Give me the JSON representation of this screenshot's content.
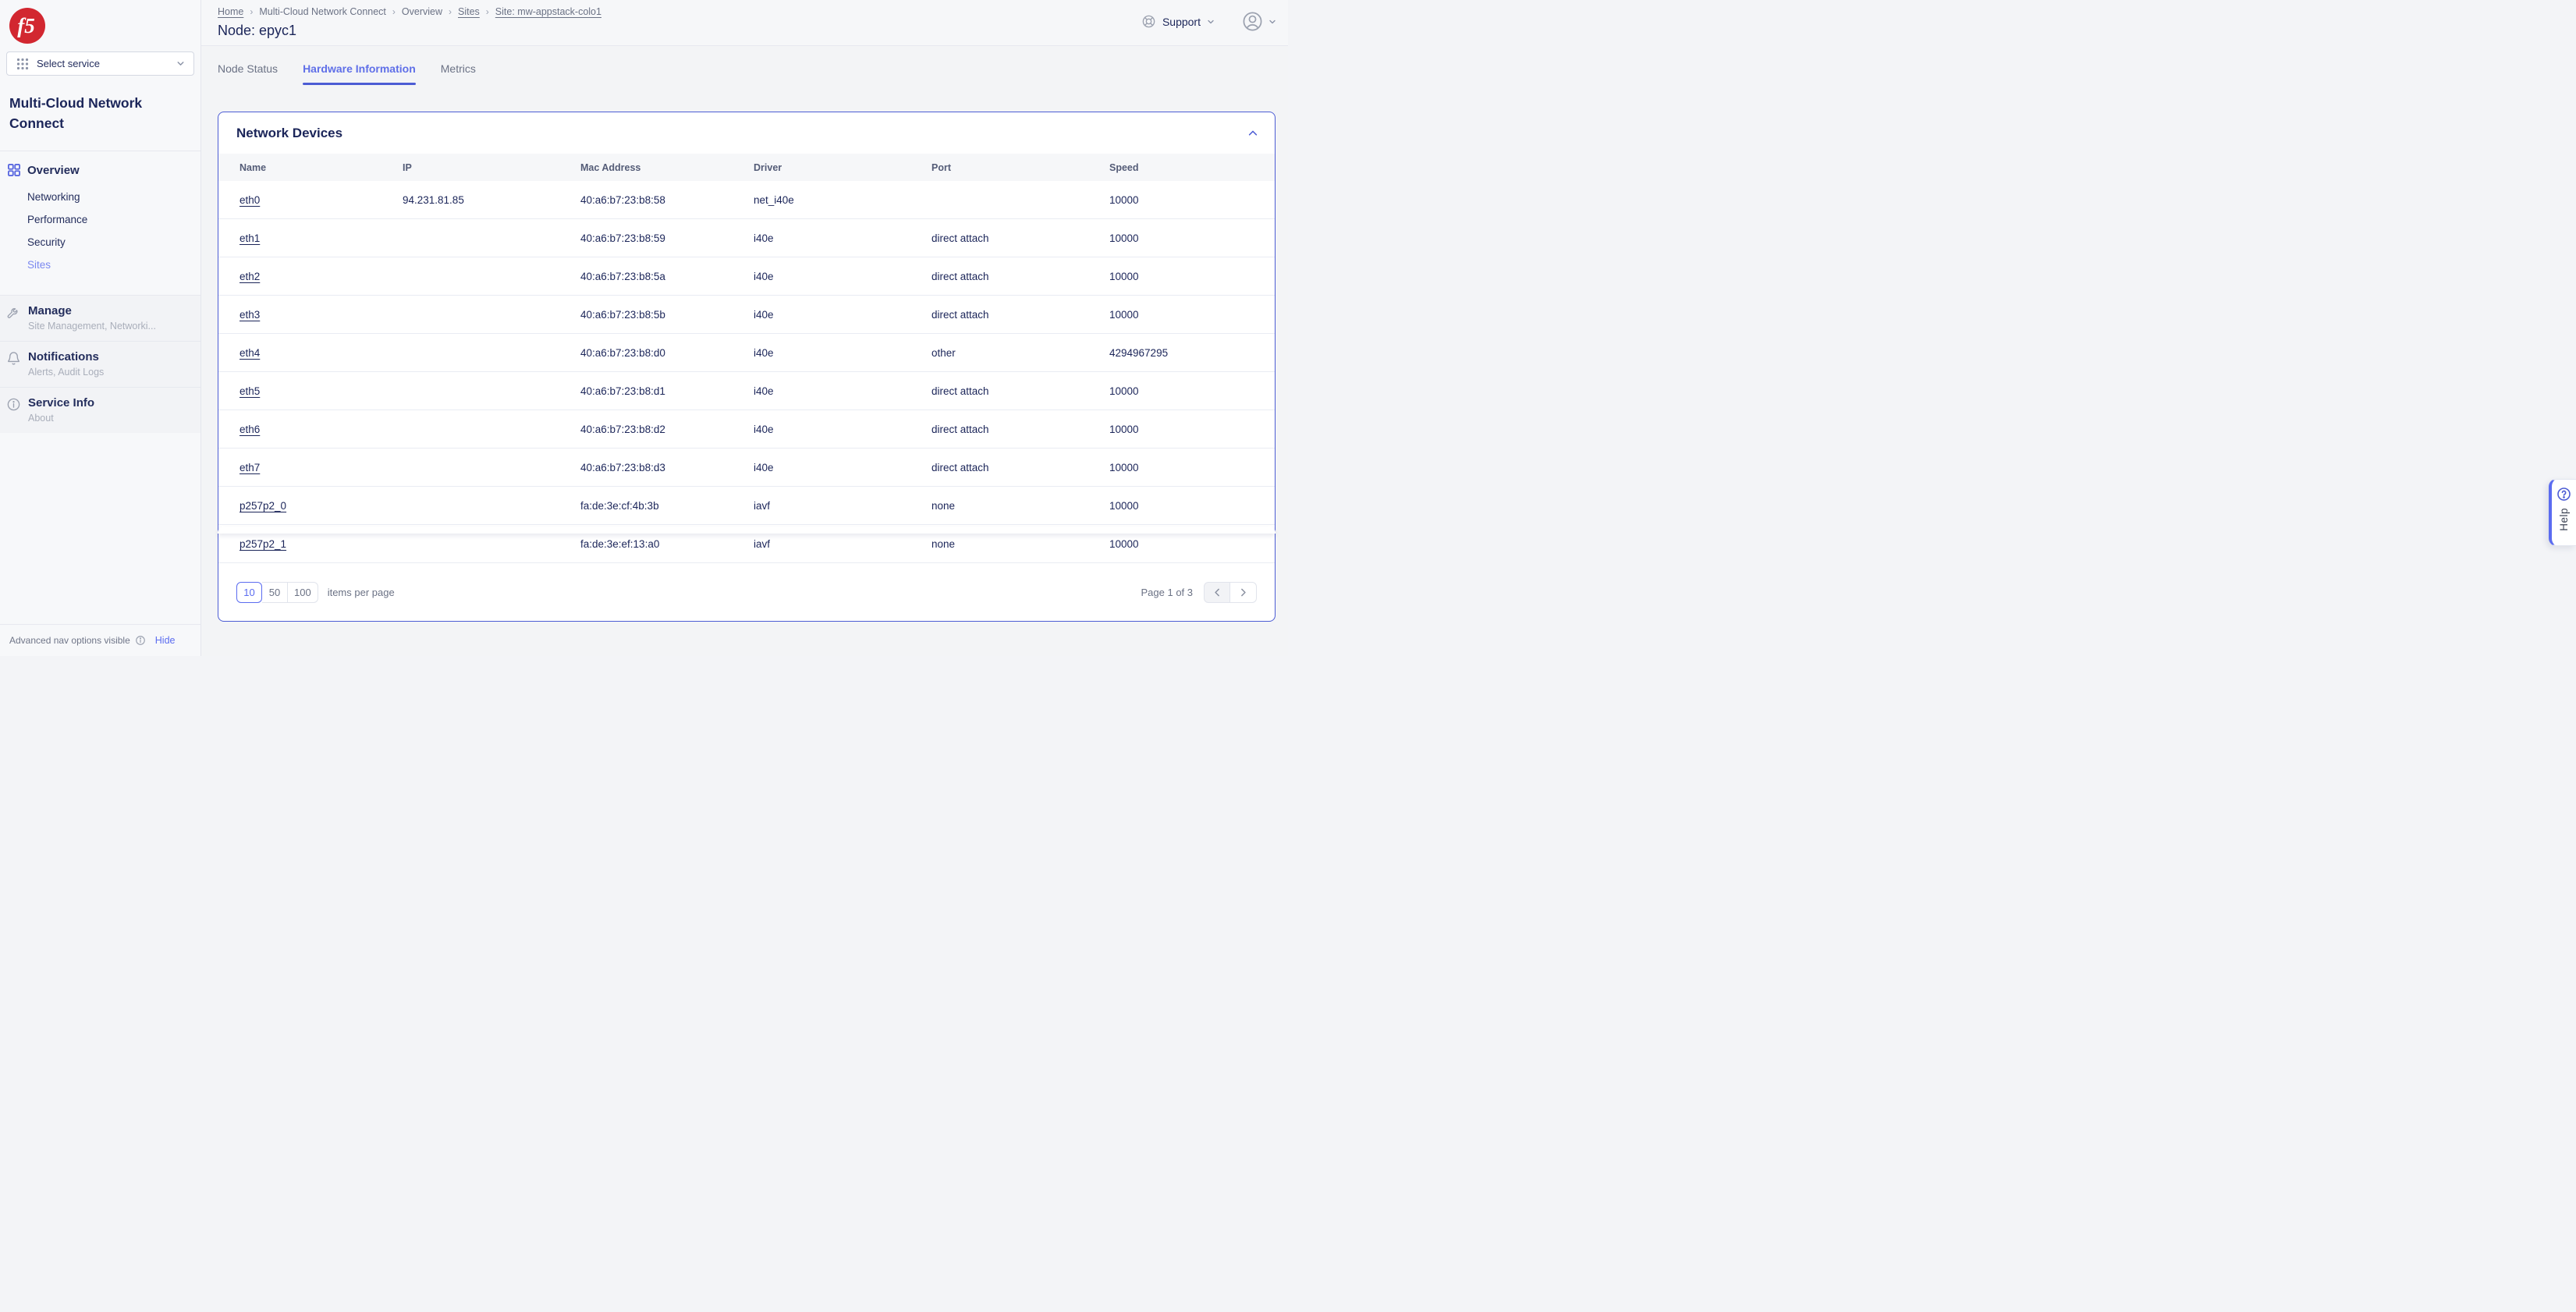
{
  "colors": {
    "accent_blue": "#4c5cd4",
    "active_tab_blue": "#5f6fe8",
    "active_nav_blue": "#7b88f0",
    "navy_text": "#1b2559",
    "gray_text": "#6b7285",
    "logo_red": "#d22730",
    "card_bg": "#ffffff",
    "page_bg": "#f3f4f6"
  },
  "sidebar": {
    "logo_text": "f5",
    "service_selector": {
      "label": "Select service"
    },
    "product_title": "Multi-Cloud Network Connect",
    "overview": {
      "label": "Overview",
      "items": [
        "Networking",
        "Performance",
        "Security",
        "Sites"
      ],
      "active_item": "Sites"
    },
    "sections": [
      {
        "label": "Manage",
        "subtitle": "Site Management, Networki...",
        "icon": "wrench-icon"
      },
      {
        "label": "Notifications",
        "subtitle": "Alerts, Audit Logs",
        "icon": "bell-icon"
      },
      {
        "label": "Service Info",
        "subtitle": "About",
        "icon": "info-icon"
      }
    ],
    "footer": {
      "text": "Advanced nav options visible",
      "action": "Hide"
    }
  },
  "header": {
    "breadcrumbs": [
      {
        "label": "Home",
        "underline": true
      },
      {
        "label": "Multi-Cloud Network Connect",
        "underline": false
      },
      {
        "label": "Overview",
        "underline": false
      },
      {
        "label": "Sites",
        "underline": true
      },
      {
        "label": "Site: mw-appstack-colo1",
        "underline": true
      }
    ],
    "title": "Node: epyc1",
    "support_label": "Support"
  },
  "tabs": [
    {
      "label": "Node Status",
      "active": false
    },
    {
      "label": "Hardware Information",
      "active": true
    },
    {
      "label": "Metrics",
      "active": false
    }
  ],
  "card": {
    "title": "Network Devices",
    "columns": [
      "Name",
      "IP",
      "Mac Address",
      "Driver",
      "Port",
      "Speed"
    ],
    "rows": [
      [
        "eth0",
        "94.231.81.85",
        "40:a6:b7:23:b8:58",
        "net_i40e",
        "",
        "10000"
      ],
      [
        "eth1",
        "",
        "40:a6:b7:23:b8:59",
        "i40e",
        "direct attach",
        "10000"
      ],
      [
        "eth2",
        "",
        "40:a6:b7:23:b8:5a",
        "i40e",
        "direct attach",
        "10000"
      ],
      [
        "eth3",
        "",
        "40:a6:b7:23:b8:5b",
        "i40e",
        "direct attach",
        "10000"
      ],
      [
        "eth4",
        "",
        "40:a6:b7:23:b8:d0",
        "i40e",
        "other",
        "4294967295"
      ],
      [
        "eth5",
        "",
        "40:a6:b7:23:b8:d1",
        "i40e",
        "direct attach",
        "10000"
      ],
      [
        "eth6",
        "",
        "40:a6:b7:23:b8:d2",
        "i40e",
        "direct attach",
        "10000"
      ],
      [
        "eth7",
        "",
        "40:a6:b7:23:b8:d3",
        "i40e",
        "direct attach",
        "10000"
      ],
      [
        "p257p2_0",
        "",
        "fa:de:3e:cf:4b:3b",
        "iavf",
        "none",
        "10000"
      ],
      [
        "p257p2_1",
        "",
        "fa:de:3e:ef:13:a0",
        "iavf",
        "none",
        "10000"
      ]
    ],
    "pagination": {
      "page_sizes": [
        "10",
        "50",
        "100"
      ],
      "selected_size": "10",
      "items_per_page_label": "items per page",
      "page_info": "Page 1 of 3"
    }
  },
  "help": {
    "label": "Help"
  }
}
